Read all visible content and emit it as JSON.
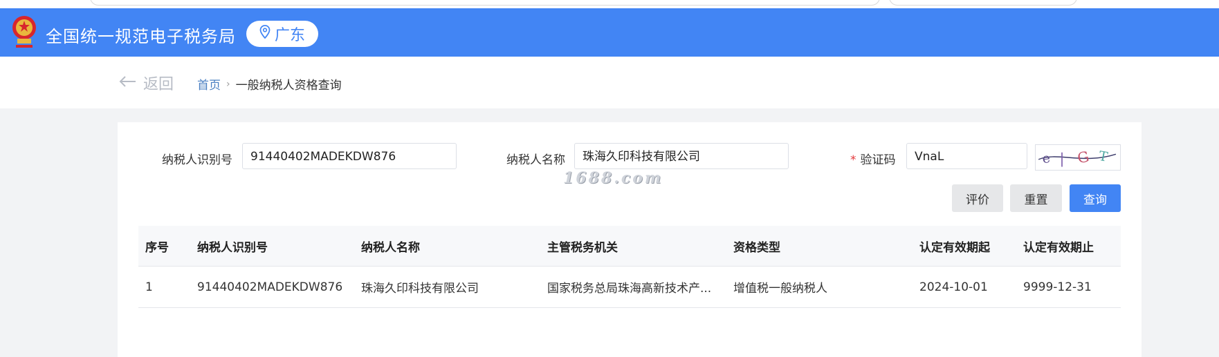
{
  "header": {
    "site_title": "全国统一规范电子税务局",
    "region": "广东"
  },
  "nav": {
    "back_label": "返回",
    "breadcrumb_home": "首页",
    "breadcrumb_current": "一般纳税人资格查询"
  },
  "form": {
    "taxpayer_id_label": "纳税人识别号",
    "taxpayer_id_value": "91440402MADEKDW876",
    "taxpayer_name_label": "纳税人名称",
    "taxpayer_name_value": "珠海久印科技有限公司",
    "captcha_label": "验证码",
    "captcha_value": "VnaL",
    "required_mark": "*",
    "watermark": "1688.com"
  },
  "buttons": {
    "evaluate": "评价",
    "reset": "重置",
    "query": "查询"
  },
  "table": {
    "headers": [
      "序号",
      "纳税人识别号",
      "纳税人名称",
      "主管税务机关",
      "资格类型",
      "认定有效期起",
      "认定有效期止"
    ],
    "rows": [
      {
        "index": "1",
        "taxpayer_id": "91440402MADEKDW876",
        "taxpayer_name": "珠海久印科技有限公司",
        "tax_authority": "国家税务总局珠海高新技术产...",
        "qualification_type": "增值税一般纳税人",
        "valid_from": "2024-10-01",
        "valid_to": "9999-12-31"
      }
    ]
  },
  "colors": {
    "header_bg": "#4285f4",
    "primary_button": "#4285f4",
    "required_star": "#e4393c",
    "link": "#4a7fc2"
  },
  "icons": {
    "emblem": "national-emblem-icon",
    "location": "location-pin-icon",
    "back": "arrow-left-icon"
  }
}
